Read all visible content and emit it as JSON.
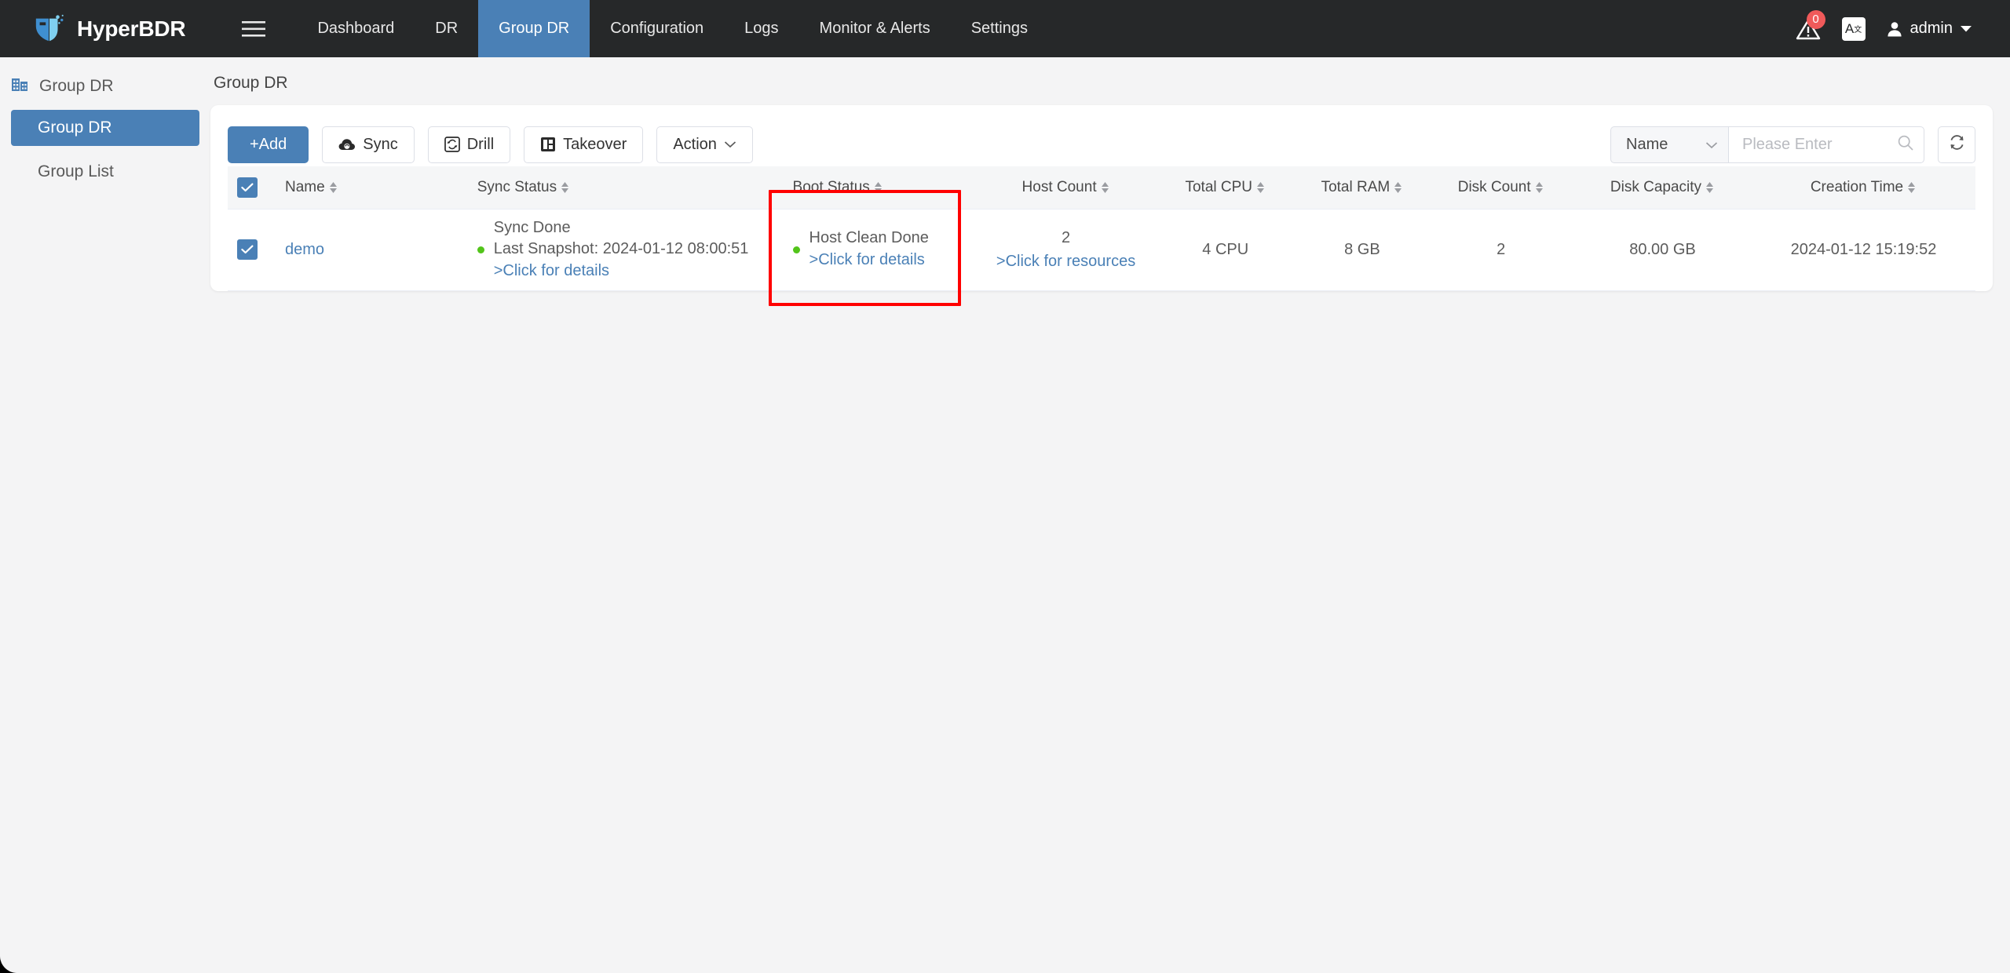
{
  "navbar": {
    "brand": "HyperBDR",
    "menu_icon": "hamburger-icon",
    "items": [
      {
        "label": "Dashboard",
        "active": false
      },
      {
        "label": "DR",
        "active": false
      },
      {
        "label": "Group DR",
        "active": true
      },
      {
        "label": "Configuration",
        "active": false
      },
      {
        "label": "Logs",
        "active": false
      },
      {
        "label": "Monitor & Alerts",
        "active": false
      },
      {
        "label": "Settings",
        "active": false
      }
    ],
    "alert_icon": "alert-warning-icon",
    "alert_badge": "0",
    "language_icon": "language-translate-icon",
    "user_icon": "user-avatar-icon",
    "user_name": "admin"
  },
  "sidebar": {
    "header": {
      "label": "Group DR",
      "icon": "building-icon"
    },
    "items": [
      {
        "label": "Group DR",
        "active": true
      },
      {
        "label": "Group List",
        "active": false
      }
    ]
  },
  "page": {
    "title": "Group DR"
  },
  "toolbar": {
    "add_label": "+Add",
    "sync_label": "Sync",
    "drill_label": "Drill",
    "takeover_label": "Takeover",
    "action_label": "Action",
    "sync_icon": "cloud-sync-icon",
    "drill_icon": "drill-recycle-icon",
    "takeover_icon": "server-takeover-icon",
    "action_caret_icon": "chevron-down-icon"
  },
  "search": {
    "field_label": "Name",
    "placeholder": "Please Enter",
    "search_icon": "search-icon",
    "dropdown_icon": "chevron-down-icon",
    "refresh_icon": "refresh-icon"
  },
  "table": {
    "columns": [
      {
        "key": "check",
        "label": ""
      },
      {
        "key": "name",
        "label": "Name"
      },
      {
        "key": "sync",
        "label": "Sync Status"
      },
      {
        "key": "boot",
        "label": "Boot Status"
      },
      {
        "key": "host",
        "label": "Host Count"
      },
      {
        "key": "cpu",
        "label": "Total CPU"
      },
      {
        "key": "ram",
        "label": "Total RAM"
      },
      {
        "key": "disk",
        "label": "Disk Count"
      },
      {
        "key": "cap",
        "label": "Disk Capacity"
      },
      {
        "key": "time",
        "label": "Creation Time"
      }
    ],
    "header_checkbox_checked": true,
    "rows": [
      {
        "checked": true,
        "name": "demo",
        "sync_status": "Sync Done",
        "sync_snapshot": "Last Snapshot: 2024-01-12 08:00:51",
        "sync_details_link": ">Click for details",
        "sync_dot_color": "#52c41a",
        "boot_status": "Host Clean Done",
        "boot_details_link": ">Click for details",
        "boot_dot_color": "#52c41a",
        "host_count": "2",
        "host_resources_link": ">Click for resources",
        "total_cpu": "4 CPU",
        "total_ram": "8 GB",
        "disk_count": "2",
        "disk_capacity": "80.00 GB",
        "creation_time": "2024-01-12 15:19:52"
      }
    ]
  },
  "annotation": {
    "color": "#ff0000",
    "target": "boot-status-column"
  },
  "colors": {
    "accent": "#4a80b6",
    "navbar_bg": "#262829",
    "page_bg": "#f4f4f5",
    "status_green": "#52c41a",
    "badge_red": "#f05a5a"
  }
}
